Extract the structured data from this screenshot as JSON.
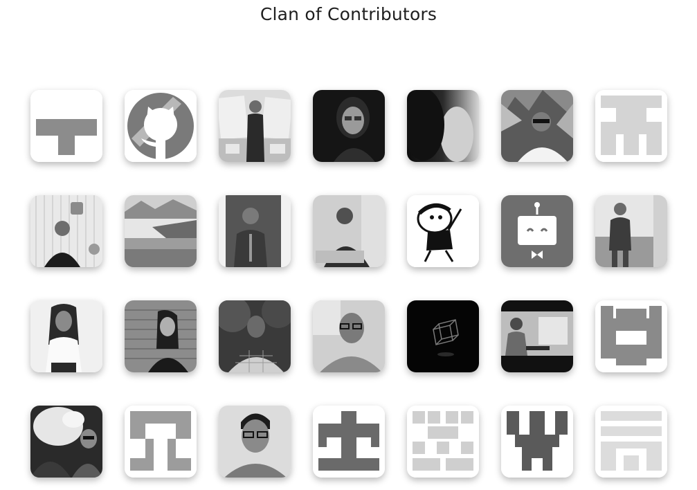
{
  "page": {
    "title": "Clan of Contributors"
  },
  "contributors": [
    {
      "avatar": "identicon-t-icon"
    },
    {
      "avatar": "github-octocat-icon"
    },
    {
      "avatar": "photo-woman-stage"
    },
    {
      "avatar": "photo-woman-glasses-dark"
    },
    {
      "avatar": "photo-dark-closeup"
    },
    {
      "avatar": "photo-man-sunglasses-mountains"
    },
    {
      "avatar": "identicon-light-gray-icon"
    },
    {
      "avatar": "photo-man-social-wall"
    },
    {
      "avatar": "photo-lake-landscape"
    },
    {
      "avatar": "photo-man-traditional-wear"
    },
    {
      "avatar": "photo-man-laptop-window"
    },
    {
      "avatar": "cartoon-shinchan-icon"
    },
    {
      "avatar": "robot-bot-icon"
    },
    {
      "avatar": "photo-woman-field"
    },
    {
      "avatar": "photo-woman-smiling-white"
    },
    {
      "avatar": "photo-woman-brick-wall"
    },
    {
      "avatar": "photo-man-checked-shirt"
    },
    {
      "avatar": "photo-man-glasses-smile"
    },
    {
      "avatar": "wireframe-cube-icon"
    },
    {
      "avatar": "photo-man-laptop-desk"
    },
    {
      "avatar": "identicon-castle-icon"
    },
    {
      "avatar": "photo-two-people-mascot"
    },
    {
      "avatar": "identicon-arch-icon"
    },
    {
      "avatar": "photo-man-glasses-portrait"
    },
    {
      "avatar": "identicon-cross-icon"
    },
    {
      "avatar": "identicon-checker-icon"
    },
    {
      "avatar": "identicon-w-icon"
    },
    {
      "avatar": "identicon-m-icon"
    }
  ]
}
